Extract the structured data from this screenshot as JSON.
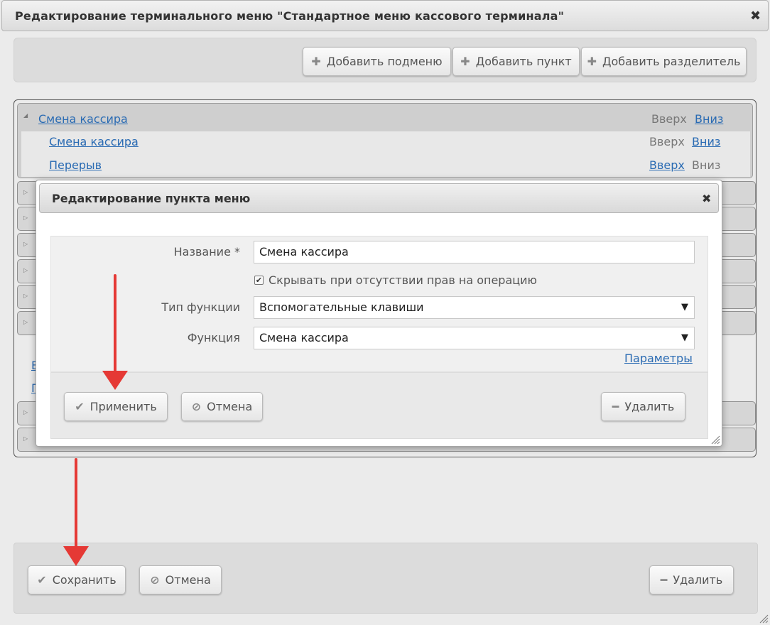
{
  "window": {
    "title": "Редактирование терминального меню \"Стандартное меню кассового терминала\"",
    "close_glyph": "✖"
  },
  "toolbar": {
    "add_submenu": "Добавить подменю",
    "add_item": "Добавить пункт",
    "add_separator": "Добавить разделитель"
  },
  "menu_tree": {
    "group": {
      "label": "Смена кассира",
      "up": "Вверх",
      "down": "Вниз"
    },
    "items": [
      {
        "label": "Смена кассира",
        "up": "Вверх",
        "down": "Вниз"
      },
      {
        "label": "Перерыв",
        "up": "Вверх",
        "down": "Вниз"
      }
    ],
    "hidden_links": [
      "В",
      "П"
    ]
  },
  "dialog": {
    "title": "Редактирование пункта меню",
    "close_glyph": "✖",
    "name_label": "Название *",
    "name_value": "Смена кассира",
    "hide_checkbox_label": "Скрывать при отсутствии прав на операцию",
    "hide_checkbox_checked": true,
    "func_type_label": "Тип функции",
    "func_type_value": "Вспомогательные клавиши",
    "function_label": "Функция",
    "function_value": "Смена кассира",
    "params_link": "Параметры",
    "apply_button": "Применить",
    "cancel_button": "Отмена",
    "delete_button": "Удалить"
  },
  "footer": {
    "save_button": "Сохранить",
    "cancel_button": "Отмена",
    "delete_button": "Удалить"
  },
  "colors": {
    "link": "#2a6bb3",
    "annotation_arrow": "#e53935"
  },
  "icons": {
    "add": "plus-icon",
    "apply": "check-icon",
    "cancel": "cancel-circle-icon",
    "delete": "minus-icon",
    "close": "close-icon",
    "expand": "triangle-icon"
  }
}
